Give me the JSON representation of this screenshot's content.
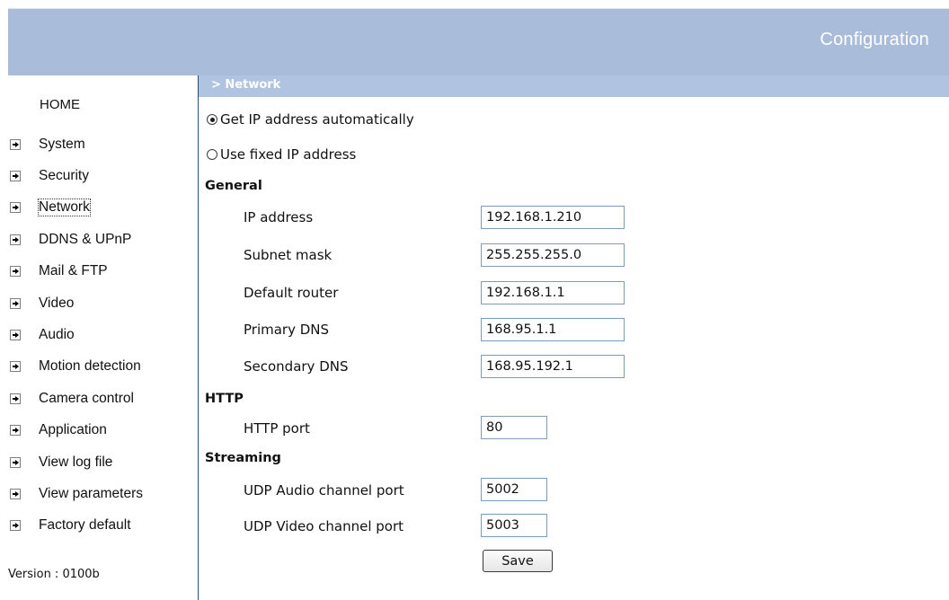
{
  "header": {
    "title": "Configuration"
  },
  "sidebar": {
    "home": "HOME",
    "items": [
      {
        "label": "System",
        "icon": "arrow-right-icon"
      },
      {
        "label": "Security",
        "icon": "arrow-right-icon"
      },
      {
        "label": "Network",
        "icon": "arrow-right-icon",
        "active": true
      },
      {
        "label": "DDNS & UPnP",
        "icon": "arrow-right-icon"
      },
      {
        "label": "Mail & FTP",
        "icon": "arrow-right-icon"
      },
      {
        "label": "Video",
        "icon": "arrow-right-icon"
      },
      {
        "label": "Audio",
        "icon": "arrow-right-icon"
      },
      {
        "label": "Motion detection",
        "icon": "arrow-right-icon"
      },
      {
        "label": "Camera control",
        "icon": "arrow-right-icon"
      },
      {
        "label": "Application",
        "icon": "arrow-right-icon"
      },
      {
        "label": "View log file",
        "icon": "arrow-right-icon"
      },
      {
        "label": "View parameters",
        "icon": "arrow-right-icon"
      },
      {
        "label": "Factory default",
        "icon": "arrow-right-icon"
      }
    ],
    "version": "Version : 0100b"
  },
  "section": {
    "title": "> Network"
  },
  "ip_mode": {
    "auto_label": "Get IP address automatically",
    "fixed_label": "Use fixed IP address",
    "selected": "auto"
  },
  "general": {
    "title": "General",
    "ip_address": {
      "label": "IP address",
      "value": "192.168.1.210"
    },
    "subnet_mask": {
      "label": "Subnet mask",
      "value": "255.255.255.0"
    },
    "default_router": {
      "label": "Default router",
      "value": "192.168.1.1"
    },
    "primary_dns": {
      "label": "Primary DNS",
      "value": "168.95.1.1"
    },
    "secondary_dns": {
      "label": "Secondary DNS",
      "value": "168.95.192.1"
    }
  },
  "http": {
    "title": "HTTP",
    "port": {
      "label": "HTTP port",
      "value": "80"
    }
  },
  "streaming": {
    "title": "Streaming",
    "audio_port": {
      "label": "UDP Audio channel port",
      "value": "5002"
    },
    "video_port": {
      "label": "UDP Video channel port",
      "value": "5003"
    }
  },
  "save_label": "Save",
  "colors": {
    "header_bg": "#a9bcd9",
    "section_bar_bg": "#b0c4e2",
    "divider": "#2f4f6f",
    "input_border": "#7f9db9"
  }
}
